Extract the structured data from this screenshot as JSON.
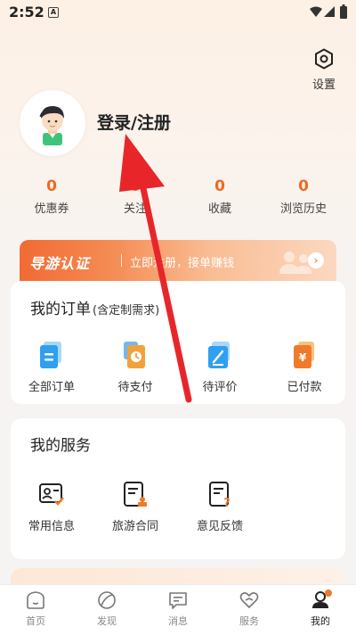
{
  "status_bar": {
    "time": "2:52",
    "a_icon": "A"
  },
  "settings": {
    "label": "设置",
    "icon": "settings-hexagon-icon"
  },
  "profile": {
    "login_label": "登录/注册"
  },
  "stats": [
    {
      "value": "0",
      "label": "优惠券"
    },
    {
      "value": "0",
      "label": "关注"
    },
    {
      "value": "0",
      "label": "收藏"
    },
    {
      "value": "0",
      "label": "浏览历史"
    }
  ],
  "banner": {
    "title": "导游认证",
    "subtitle": "立即注册，接单赚钱"
  },
  "orders": {
    "title": "我的订单",
    "title_sub": "(含定制需求)",
    "items": [
      {
        "label": "全部订单",
        "icon": "all-orders-icon"
      },
      {
        "label": "待支付",
        "icon": "pending-payment-icon"
      },
      {
        "label": "待评价",
        "icon": "pending-review-icon"
      },
      {
        "label": "已付款",
        "icon": "paid-icon"
      }
    ]
  },
  "services": {
    "title": "我的服务",
    "items": [
      {
        "label": "常用信息",
        "icon": "contact-info-icon"
      },
      {
        "label": "旅游合同",
        "icon": "travel-contract-icon"
      },
      {
        "label": "意见反馈",
        "icon": "feedback-icon"
      }
    ]
  },
  "tabbar": [
    {
      "label": "首页",
      "icon": "home-icon"
    },
    {
      "label": "发现",
      "icon": "discover-icon"
    },
    {
      "label": "消息",
      "icon": "message-icon"
    },
    {
      "label": "服务",
      "icon": "service-icon"
    },
    {
      "label": "我的",
      "icon": "profile-icon"
    }
  ],
  "colors": {
    "accent": "#ef6a1f",
    "banner_start": "#f26a33",
    "annotation_red": "#e8262a"
  }
}
